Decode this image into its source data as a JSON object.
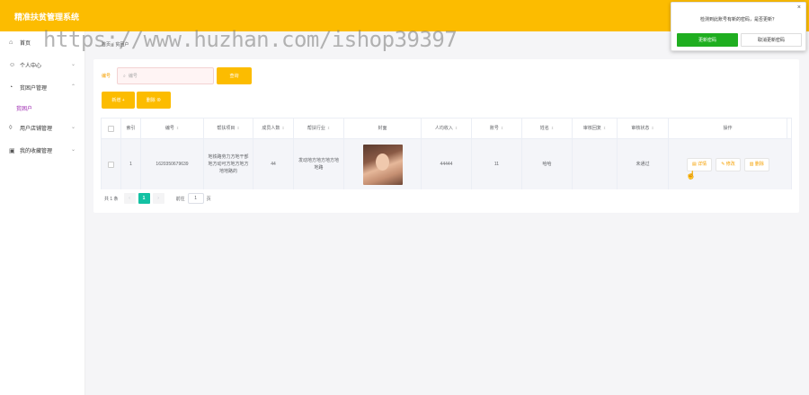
{
  "app": {
    "title": "精准扶贫管理系统"
  },
  "watermark": "https://www.huzhan.com/ishop39397",
  "sidebar": {
    "items": [
      {
        "label": "首页",
        "icon": "home-icon",
        "glyph": "⌂"
      },
      {
        "label": "个人中心",
        "icon": "user-icon",
        "glyph": "☺"
      },
      {
        "label": "贫困户管理",
        "icon": "bell-icon",
        "glyph": "◔"
      },
      {
        "label": "用户店铺管理",
        "icon": "shop-icon",
        "glyph": "◊"
      },
      {
        "label": "我的收藏管理",
        "icon": "collection-icon",
        "glyph": "▣"
      }
    ],
    "submenu": {
      "label": "贫困户"
    }
  },
  "breadcrumb": {
    "home": "首页",
    "current": "贫困户"
  },
  "search": {
    "label": "编号",
    "placeholder": "编号",
    "button_label": "查询",
    "search_glyph": "⌕"
  },
  "actions": {
    "add_label": "新增 +",
    "delete_label": "删除 ⊗"
  },
  "table": {
    "columns": [
      "索引",
      "编号",
      "帮扶项目",
      "成员人数",
      "帮扶行业",
      "封面",
      "人均收入",
      "账号",
      "姓名",
      "审核回复",
      "审核状态",
      "操作"
    ],
    "rows": [
      {
        "index": "1",
        "code": "1620350679639",
        "project": "地铁路劳力方地干部地方动可方地方地方地地路的",
        "members": "44",
        "industry": "发动地方地方地方地地路",
        "income": "44444",
        "account": "11",
        "name": "哈哈",
        "reply": "",
        "status": "未通过",
        "ops": {
          "detail": "详情",
          "edit": "修改",
          "delete": "删除"
        }
      }
    ]
  },
  "pagination": {
    "total": "共 1 条",
    "prev": "‹",
    "page": "1",
    "next": "›",
    "goto_label": "前往",
    "goto_value": "1",
    "page_unit": "页"
  },
  "popup": {
    "message": "检测到此账号有新的密码，是否更新？",
    "confirm": "更新密码",
    "cancel": "取消更新密码",
    "close": "×"
  },
  "colors": {
    "accent": "#fcbc00",
    "popup_confirm": "#1fae20",
    "submenu_active": "#9c27b0",
    "page_active": "#13c1a3"
  }
}
